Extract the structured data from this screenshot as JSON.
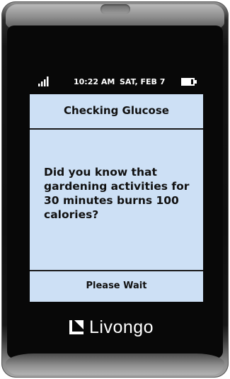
{
  "status_bar": {
    "time": "10:22 AM",
    "date": "SAT, FEB 7",
    "signal_icon": "signal-bars-icon",
    "battery_icon": "battery-icon"
  },
  "screen": {
    "title": "Checking Glucose",
    "message": "Did you know that gardening activities for 30 minutes burns 100 calories?",
    "footer": "Please Wait"
  },
  "brand": {
    "logo_icon": "livongo-logo-icon",
    "name": "Livongo"
  },
  "colors": {
    "screen_background": "#cde0f5",
    "device_face": "#080808",
    "text": "#111111"
  }
}
